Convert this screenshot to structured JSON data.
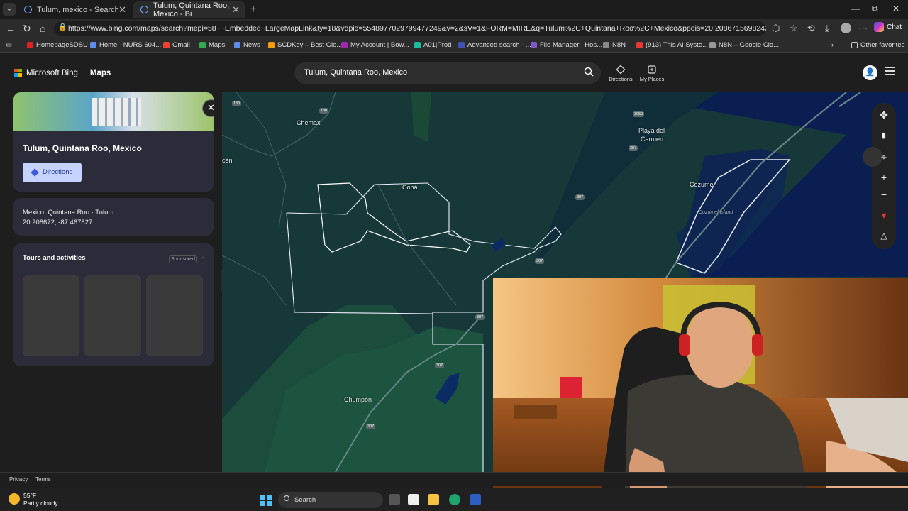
{
  "browser": {
    "tabs": [
      {
        "title": "Tulum, mexico - Search",
        "active": false
      },
      {
        "title": "Tulum, Quintana Roo, Mexico - Bi",
        "active": true
      }
    ],
    "url": "https://www.bing.com/maps/search?mepi=58~~Embedded~LargeMapLink&ty=18&vdpid=5548977029799477249&v=2&sV=1&FORM=MIRE&q=Tulum%2C+Quintana+Roo%2C+Mexico&ppois=20.20867156982422_-87.46782684...",
    "chat_label": "Chat",
    "favorites": [
      {
        "label": "HomepageSDSU",
        "color": "#d22"
      },
      {
        "label": "Home - NURS 604...",
        "color": "#5b8def"
      },
      {
        "label": "Gmail",
        "color": "#ea4335"
      },
      {
        "label": "Maps",
        "color": "#34a853"
      },
      {
        "label": "News",
        "color": "#5b8def"
      },
      {
        "label": "SCDKey – Best Glo...",
        "color": "#f39c12"
      },
      {
        "label": "My Account | Bow...",
        "color": "#9c27b0"
      },
      {
        "label": "A01|Prod",
        "color": "#1abc9c"
      },
      {
        "label": "Advanced search - ...",
        "color": "#3f51b5"
      },
      {
        "label": "File Manager | Hos...",
        "color": "#7e57c2"
      },
      {
        "label": "N8N",
        "color": "#888"
      },
      {
        "label": "(913) This AI Syste...",
        "color": "#e53935"
      },
      {
        "label": "N8N – Google Clo...",
        "color": "#999"
      }
    ],
    "other_favorites": "Other favorites"
  },
  "bing": {
    "brand": "Microsoft Bing",
    "product": "Maps",
    "search_value": "Tulum, Quintana Roo, Mexico",
    "directions_label": "Directions",
    "my_places_label": "My Places"
  },
  "panel": {
    "place_title": "Tulum, Quintana Roo, Mexico",
    "directions_button": "Directions",
    "address_line": "Mexico, Quintana Roo · Tulum",
    "coords": "20.208672, -87.467827",
    "tours_title": "Tours and activities",
    "sponsored": "Sponsored"
  },
  "map": {
    "labels": [
      "Chemax",
      "Cobá",
      "Playa del",
      "Carmen",
      "Cozumel",
      "Cozumel Island",
      "Chumpón",
      "cén"
    ],
    "road_shields": [
      "180",
      "180",
      "3050",
      "307",
      "307",
      "307",
      "307",
      "307",
      "307"
    ]
  },
  "footer": {
    "privacy": "Privacy",
    "terms": "Terms"
  },
  "taskbar": {
    "temperature": "55°F",
    "condition": "Partly cloudy",
    "search_label": "Search"
  }
}
